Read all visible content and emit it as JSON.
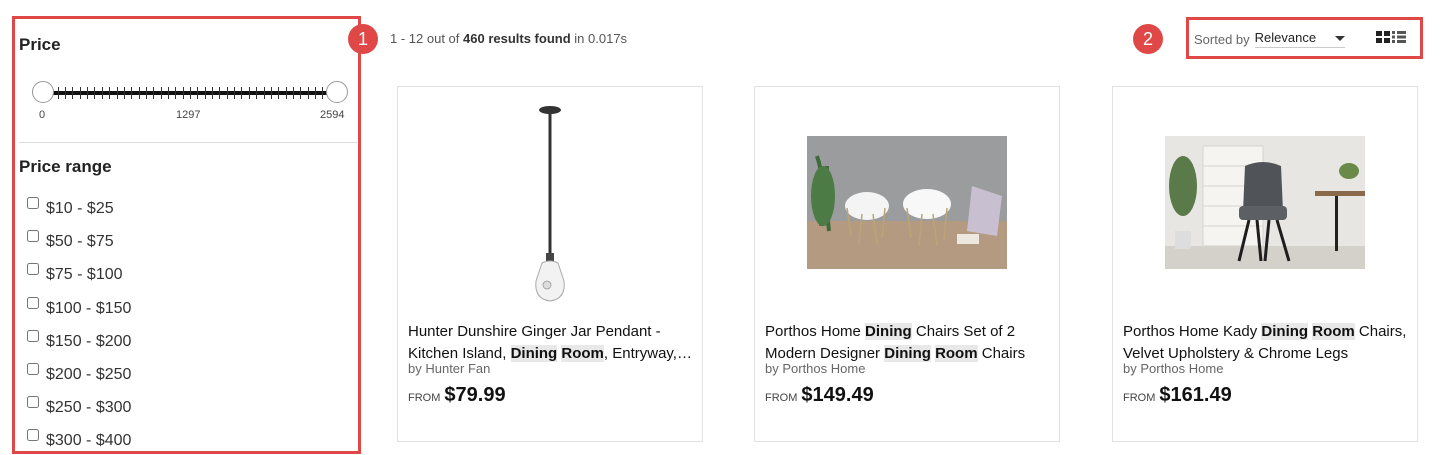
{
  "callouts": {
    "one": "1",
    "two": "2"
  },
  "filters": {
    "price_title": "Price",
    "slider": {
      "min_label": "0",
      "mid_label": "1297",
      "max_label": "2594"
    },
    "range_title": "Price range",
    "ranges": [
      "$10 - $25",
      "$50 - $75",
      "$75 - $100",
      "$100 - $150",
      "$150 - $200",
      "$200 - $250",
      "$250 - $300",
      "$300 - $400"
    ]
  },
  "results": {
    "range_text": "1 - 12 out of",
    "count_text": "460 results found",
    "time_text": "in 0.017s"
  },
  "sort": {
    "label": "Sorted by",
    "value": "Relevance"
  },
  "products": [
    {
      "title_parts": [
        "Hunter Dunshire Ginger Jar Pendant - Kitchen Island, ",
        "Dining",
        " ",
        "Room",
        ", Entryway, Hallway"
      ],
      "brand": "by Hunter Fan",
      "from": "FROM",
      "price": "$79.99"
    },
    {
      "title_parts": [
        "Porthos Home ",
        "Dining",
        " Chairs Set of 2 Modern Designer ",
        "Dining",
        " ",
        "Room",
        " Chairs"
      ],
      "brand": "by Porthos Home",
      "from": "FROM",
      "price": "$149.49"
    },
    {
      "title_parts": [
        "Porthos Home Kady ",
        "Dining",
        " ",
        "Room",
        " Chairs, Velvet Upholstery & Chrome Legs"
      ],
      "brand": "by Porthos Home",
      "from": "FROM",
      "price": "$161.49"
    }
  ]
}
